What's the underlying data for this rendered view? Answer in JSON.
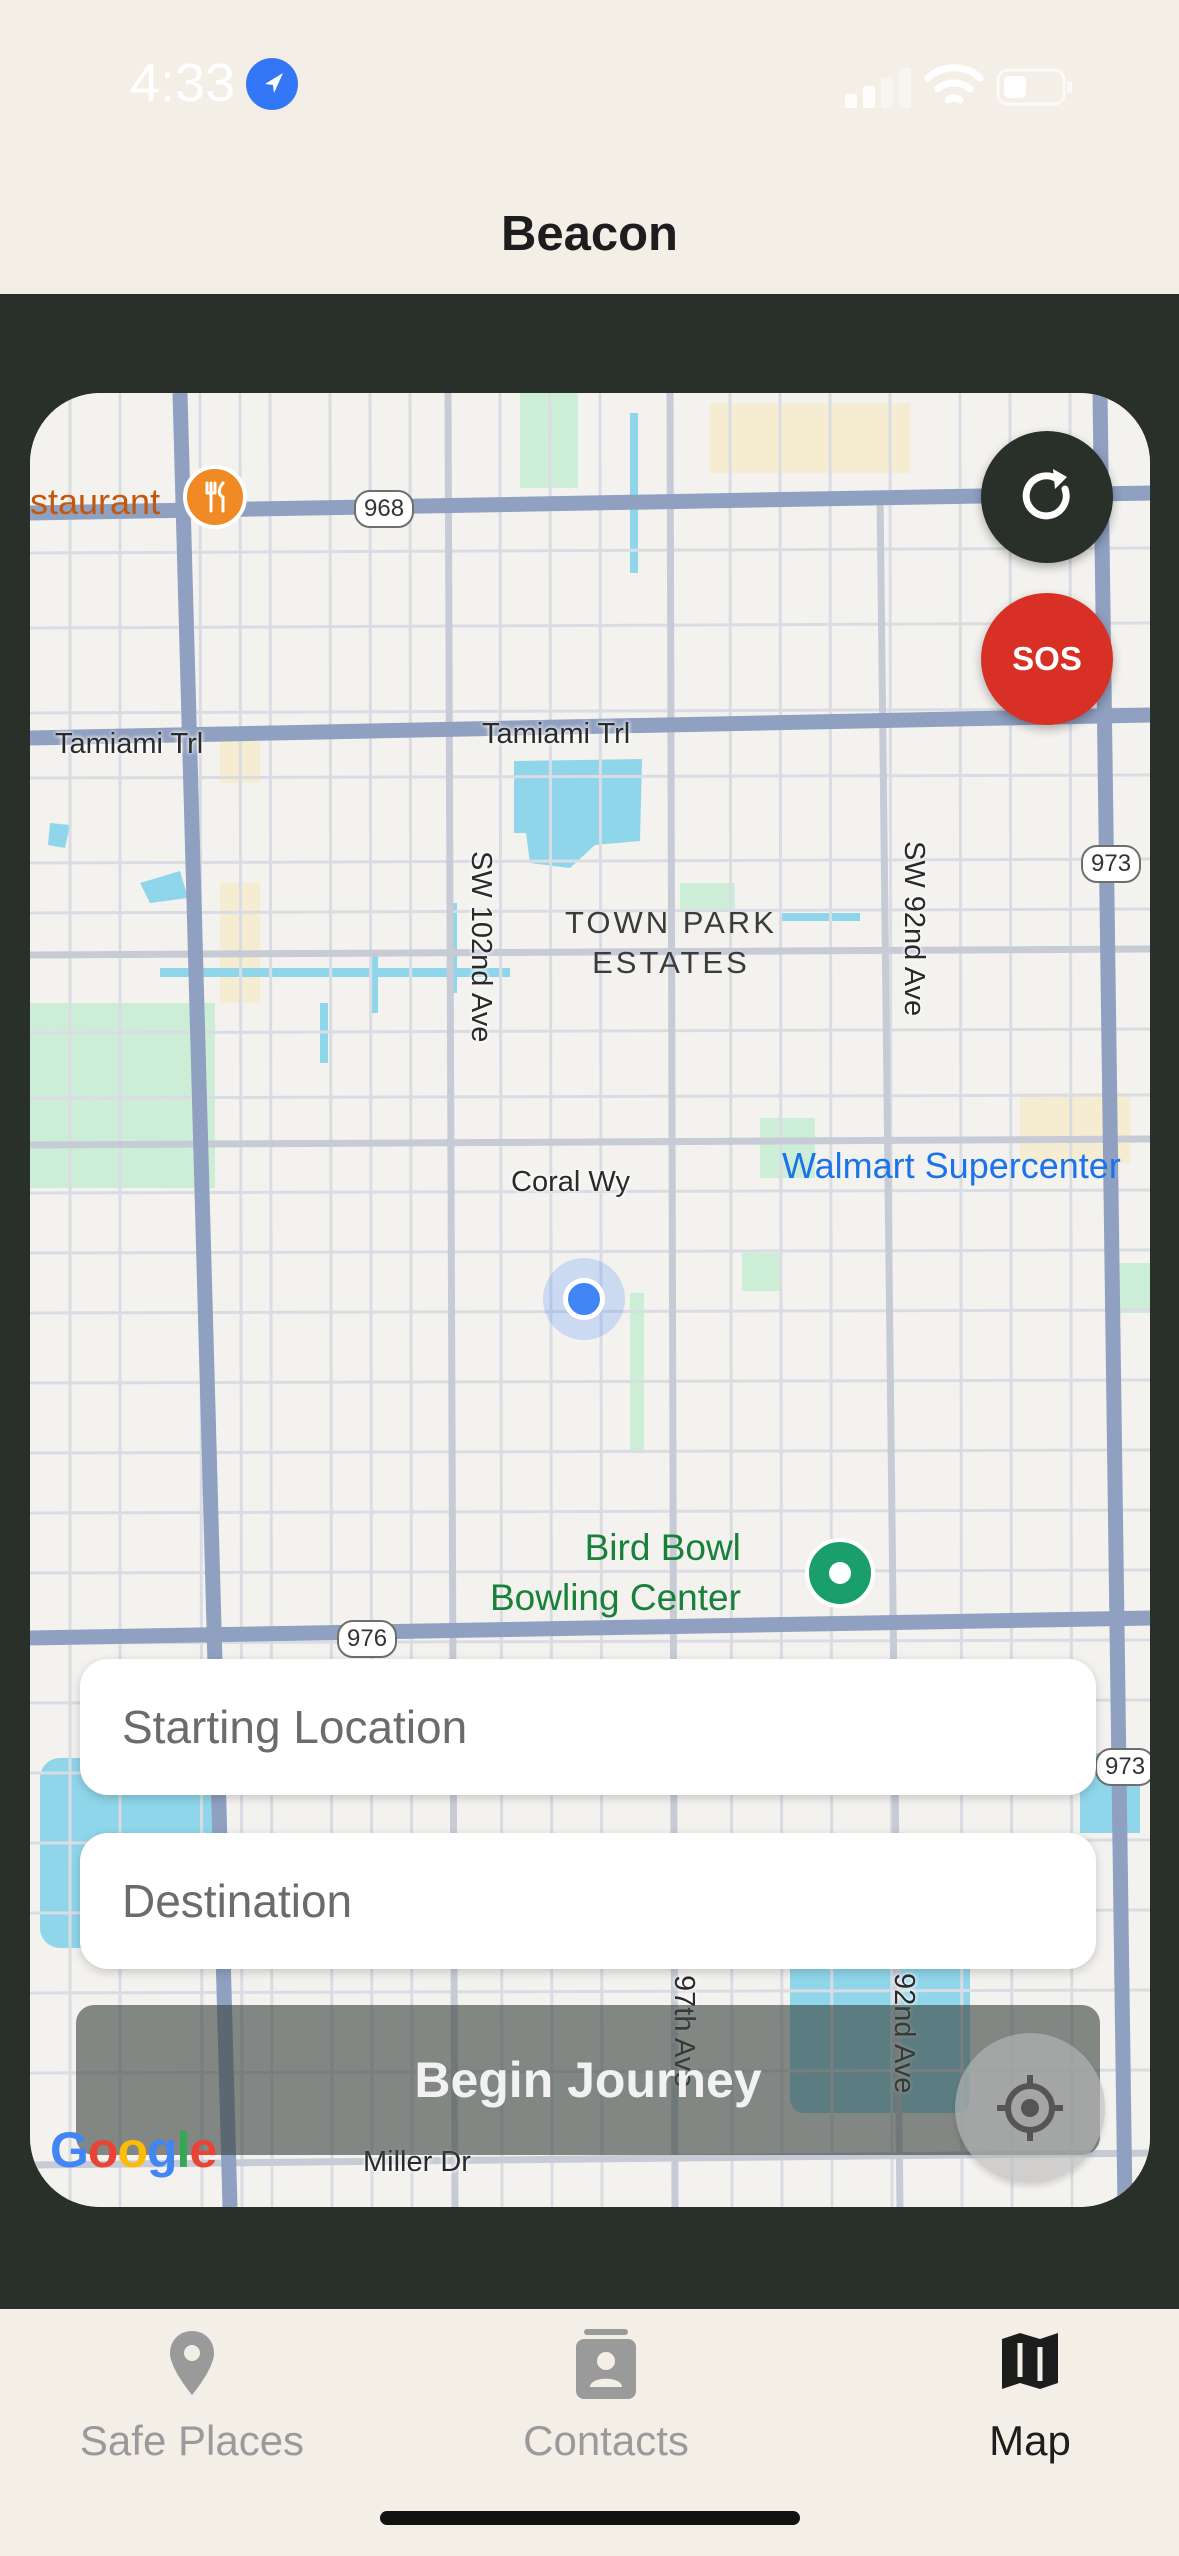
{
  "status_bar": {
    "time": "4:33"
  },
  "header": {
    "title": "Beacon"
  },
  "map": {
    "roads": {
      "tamiami_left": "Tamiami Trl",
      "tamiami_center": "Tamiami Trl",
      "sw_102nd": "SW 102nd Ave",
      "sw_92nd": "SW 92nd Ave",
      "coral_wy": "Coral Wy",
      "miller_dr": "Miller Dr",
      "ave_97th": "97th Ave",
      "ave_92nd_lower": "92nd Ave"
    },
    "shields": {
      "r968": "968",
      "r973_top": "973",
      "r976": "976",
      "r973_bottom": "973"
    },
    "areas": {
      "town_park": "TOWN PARK\nESTATES"
    },
    "pois": {
      "walmart": "Walmart Supercenter",
      "bird_bowl": "Bird Bowl\nBowling Center",
      "restaurant": "staurant"
    },
    "attribution": "Google"
  },
  "buttons": {
    "sos": "SOS",
    "begin_journey": "Begin Journey"
  },
  "inputs": {
    "start_placeholder": "Starting Location",
    "destination_placeholder": "Destination"
  },
  "tabs": [
    {
      "label": "Safe Places",
      "active": false
    },
    {
      "label": "Contacts",
      "active": false
    },
    {
      "label": "Map",
      "active": true
    }
  ],
  "colors": {
    "accent_dark": "#283029",
    "sos_red": "#d93025",
    "background": "#f3efe7",
    "tab_inactive": "#9a9a9a"
  }
}
